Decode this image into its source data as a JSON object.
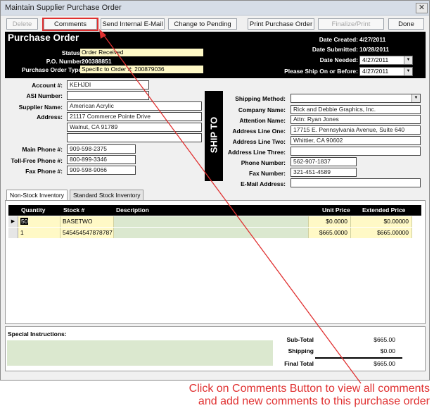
{
  "window": {
    "title": "Maintain Supplier Purchase Order",
    "close_glyph": "✕"
  },
  "toolbar": {
    "delete": "Delete",
    "comments": "Comments",
    "send_email": "Send Internal E-Mail",
    "change_pending": "Change to Pending",
    "print_po": "Print Purchase Order",
    "finalize_print": "Finalize/Print",
    "done": "Done"
  },
  "header": {
    "title": "Purchase Order",
    "status_label": "Status :",
    "status": "Order Received",
    "po_label": "P.O. Number:",
    "po_number": "200388851",
    "type_label": "Purchase Order Type:",
    "type": "Specific to Order #: 200879036",
    "date_created_label": "Date Created:",
    "date_created": "4/27/2011",
    "date_submitted_label": "Date Submitted:",
    "date_submitted": "10/28/2011",
    "date_needed_label": "Date Needed:",
    "date_needed": "4/27/2011",
    "ship_before_label": "Please Ship On or Before:",
    "ship_before": "4/27/2011"
  },
  "supplier": {
    "account_label": "Account #:",
    "account": "KEHJDI",
    "asi_label": "ASI Number:",
    "asi": "",
    "name_label": "Supplier Name:",
    "name": "American Acrylic",
    "address_label": "Address:",
    "address1": "21117 Commerce Pointe Drive",
    "address2": "Walnut, CA 91789",
    "address3": "",
    "main_phone_label": "Main Phone #:",
    "main_phone": "909-598-2375",
    "tollfree_label": "Toll-Free Phone #:",
    "tollfree": "800-899-3346",
    "fax_label": "Fax Phone #:",
    "fax": "909-598-9066"
  },
  "ship_to": {
    "banner": "SHIP TO",
    "method_label": "Shipping Method:",
    "method": "",
    "company_label": "Company Name:",
    "company": "Rick and Debbie Graphics, Inc.",
    "attention_label": "Attention Name:",
    "attention": "Attn: Ryan Jones",
    "line1_label": "Address Line One:",
    "line1": "17715 E. Pennsylvania Avenue, Suite 640",
    "line2_label": "Address Line Two:",
    "line2": "Whittier, CA  90602",
    "line3_label": "Address Line Three:",
    "line3": "",
    "phone_label": "Phone Number:",
    "phone": "562-907-1837",
    "fax_label": "Fax Number:",
    "fax": "321-451-4589",
    "email_label": "E-Mail Address:",
    "email": ""
  },
  "tabs": {
    "non_stock": "Non-Stock Inventory",
    "standard": "Standard Stock Inventory"
  },
  "grid": {
    "headers": {
      "qty": "Quantity",
      "stock": "Stock #",
      "desc": "Description",
      "unit": "Unit Price",
      "ext": "Extended Price"
    },
    "rows": [
      {
        "qty": "50",
        "stock": "BASETWO",
        "desc": "",
        "unit": "$0.0000",
        "ext": "$0.00000"
      },
      {
        "qty": "1",
        "stock": "545454547878787",
        "desc": "",
        "unit": "$665.0000",
        "ext": "$665.00000"
      }
    ],
    "row_marker": "▶"
  },
  "special": {
    "label": "Special Instructions:",
    "value": ""
  },
  "totals": {
    "subtotal_label": "Sub-Total",
    "subtotal": "$665.00",
    "shipping_label": "Shipping",
    "shipping": "$0.00",
    "final_label": "Final Total",
    "final": "$665.00"
  },
  "annotation": {
    "line1": "Click on Comments Button to view all comments",
    "line2": "and add new comments to this purchase order",
    "color": "#e03030"
  }
}
